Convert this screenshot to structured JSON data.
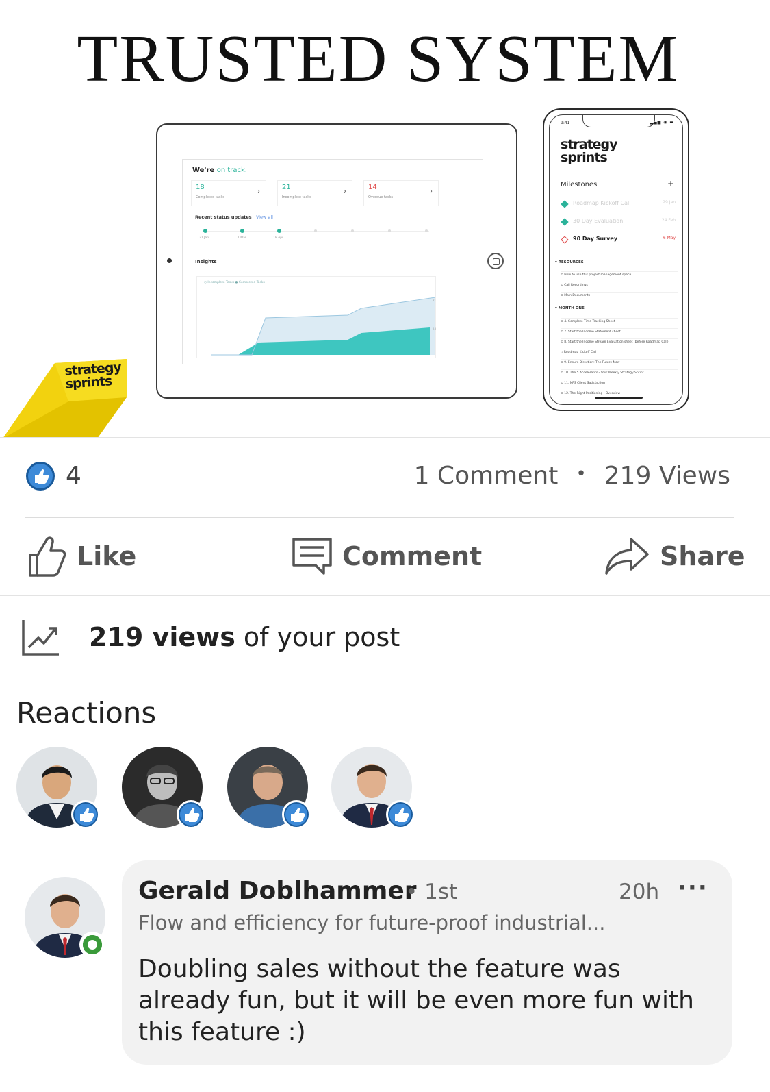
{
  "post_image": {
    "headline": "TRUSTED SYSTEM",
    "brand_logo_line1": "strategy",
    "brand_logo_line2": "sprints",
    "tablet": {
      "status_prefix": "We're",
      "status_highlight": "on track.",
      "stats": [
        {
          "value": "18",
          "label": "Completed tasks"
        },
        {
          "value": "21",
          "label": "Incomplete tasks"
        },
        {
          "value": "14",
          "label": "Overdue tasks"
        }
      ],
      "recent_label": "Recent status updates",
      "recent_link": "View all",
      "timeline_dates": [
        "31 Jan",
        "1 Mar",
        "18 Apr"
      ],
      "insights_label": "Insights",
      "legend": "○ Incomplete Tasks  ● Completed Tasks",
      "chart_end_labels": [
        "21",
        "14"
      ]
    },
    "phone": {
      "time": "9:41",
      "milestones_label": "Milestones",
      "milestones": [
        {
          "label": "Roadmap Kickoff Call",
          "date": "29 Jan",
          "state": "done"
        },
        {
          "label": "30 Day Evaluation",
          "date": "24 Feb",
          "state": "done"
        },
        {
          "label": "90 Day Survey",
          "date": "6 May",
          "state": "upcoming"
        }
      ],
      "resources_label": "RESOURCES",
      "resources": [
        "How to use this project management space",
        "Call Recordings",
        "Main Documents"
      ],
      "month_label": "MONTH ONE",
      "month_items": [
        "4. Complete Time Tracking Sheet",
        "7. Start the Income Statement sheet",
        "8. Start the Income Stream Evaluation sheet (before Roadmap Call)",
        "Roadmap Kickoff Call",
        "9. Ensure Direction: The Future Now",
        "10. The 5 Accelerants - Your Weekly Strategy Sprint",
        "11. NPS Client Satisfaction",
        "12. The Right Positioning - Overview"
      ]
    }
  },
  "social": {
    "like_count": "4",
    "comments": "1 Comment",
    "separator": "•",
    "views": "219 Views"
  },
  "actions": {
    "like": "Like",
    "comment": "Comment",
    "share": "Share"
  },
  "analytics": {
    "views_bold": "219 views",
    "views_rest": " of your post"
  },
  "reactions": {
    "title": "Reactions"
  },
  "comment": {
    "author": "Gerald Doblhammer",
    "degree": "• 1st",
    "time": "20h",
    "more": "···",
    "headline": "Flow and efficiency for future-proof industrial...",
    "body": "Doubling sales without the feature was already fun, but it will be even more fun with this feature :)"
  },
  "colors": {
    "like_blue": "#3d8ad8",
    "brand_yellow": "#f2d20f",
    "teal": "#2bb39a",
    "online_green": "#3a9a3a"
  }
}
